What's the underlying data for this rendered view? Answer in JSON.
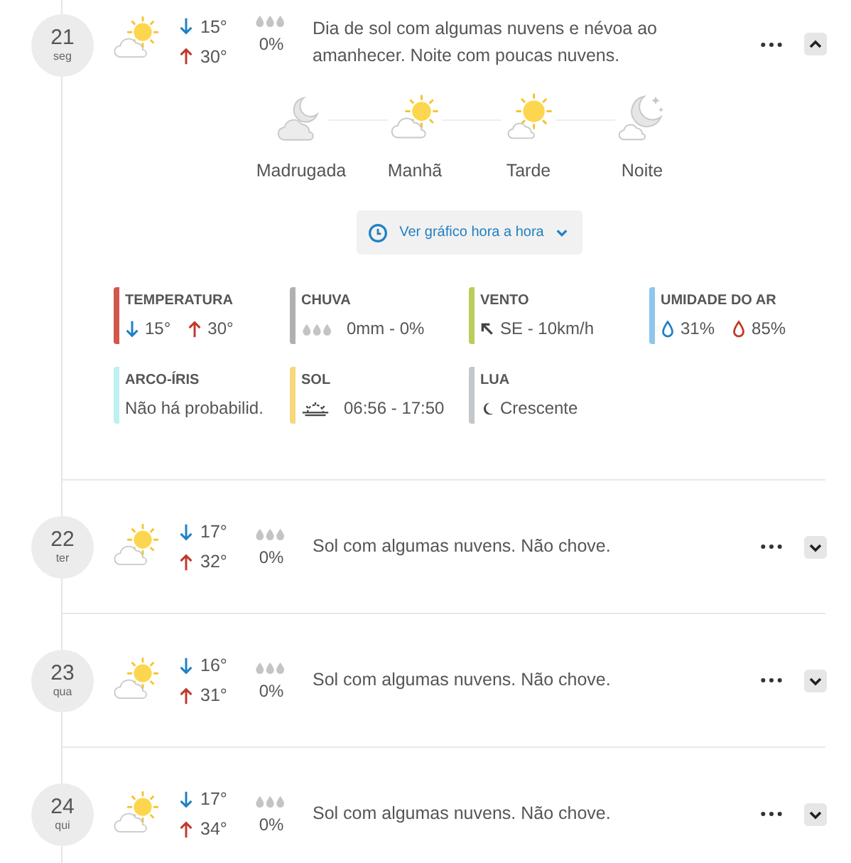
{
  "days": [
    {
      "day": "21",
      "weekday": "seg",
      "kind": "sun-cloud",
      "min": "15°",
      "max": "30°",
      "rain": "0%",
      "description": "Dia de sol com algumas nuvens e névoa ao amanhecer. Noite com poucas nuvens.",
      "expanded": true,
      "periods": [
        {
          "kind": "moon-cloud",
          "label": "Madrugada"
        },
        {
          "kind": "sun-cloud",
          "label": "Manhã"
        },
        {
          "kind": "sun-small-cloud",
          "label": "Tarde"
        },
        {
          "kind": "moon-stars-cloud",
          "label": "Noite"
        }
      ],
      "hourly_button": "Ver gráfico hora a hora",
      "details": [
        {
          "kind": "temperature",
          "label": "TEMPERATURA",
          "color": "#d0574b",
          "min": "15°",
          "max": "30°"
        },
        {
          "kind": "rain",
          "label": "CHUVA",
          "color": "#b0b0b0",
          "value": "0mm - 0%"
        },
        {
          "kind": "wind",
          "label": "VENTO",
          "color": "#b9cc5c",
          "value": "SE - 10km/h"
        },
        {
          "kind": "humidity",
          "label": "UMIDADE DO AR",
          "color": "#8ec6ec",
          "min": "31%",
          "max": "85%"
        },
        {
          "kind": "text",
          "label": "ARCO-ÍRIS",
          "color": "#bff0f2",
          "value": "Não há probabilid."
        },
        {
          "kind": "sun",
          "label": "SOL",
          "color": "#f6d97c",
          "value": "06:56 - 17:50"
        },
        {
          "kind": "moon",
          "label": "LUA",
          "color": "#c3c7cc",
          "value": "Crescente"
        }
      ]
    },
    {
      "day": "22",
      "weekday": "ter",
      "kind": "sun-cloud",
      "min": "17°",
      "max": "32°",
      "rain": "0%",
      "description": "Sol com algumas nuvens. Não chove.",
      "expanded": false
    },
    {
      "day": "23",
      "weekday": "qua",
      "kind": "sun-cloud",
      "min": "16°",
      "max": "31°",
      "rain": "0%",
      "description": "Sol com algumas nuvens. Não chove.",
      "expanded": false
    },
    {
      "day": "24",
      "weekday": "qui",
      "kind": "sun-cloud",
      "min": "17°",
      "max": "34°",
      "rain": "0%",
      "description": "Sol com algumas nuvens. Não chove.",
      "expanded": false
    }
  ]
}
